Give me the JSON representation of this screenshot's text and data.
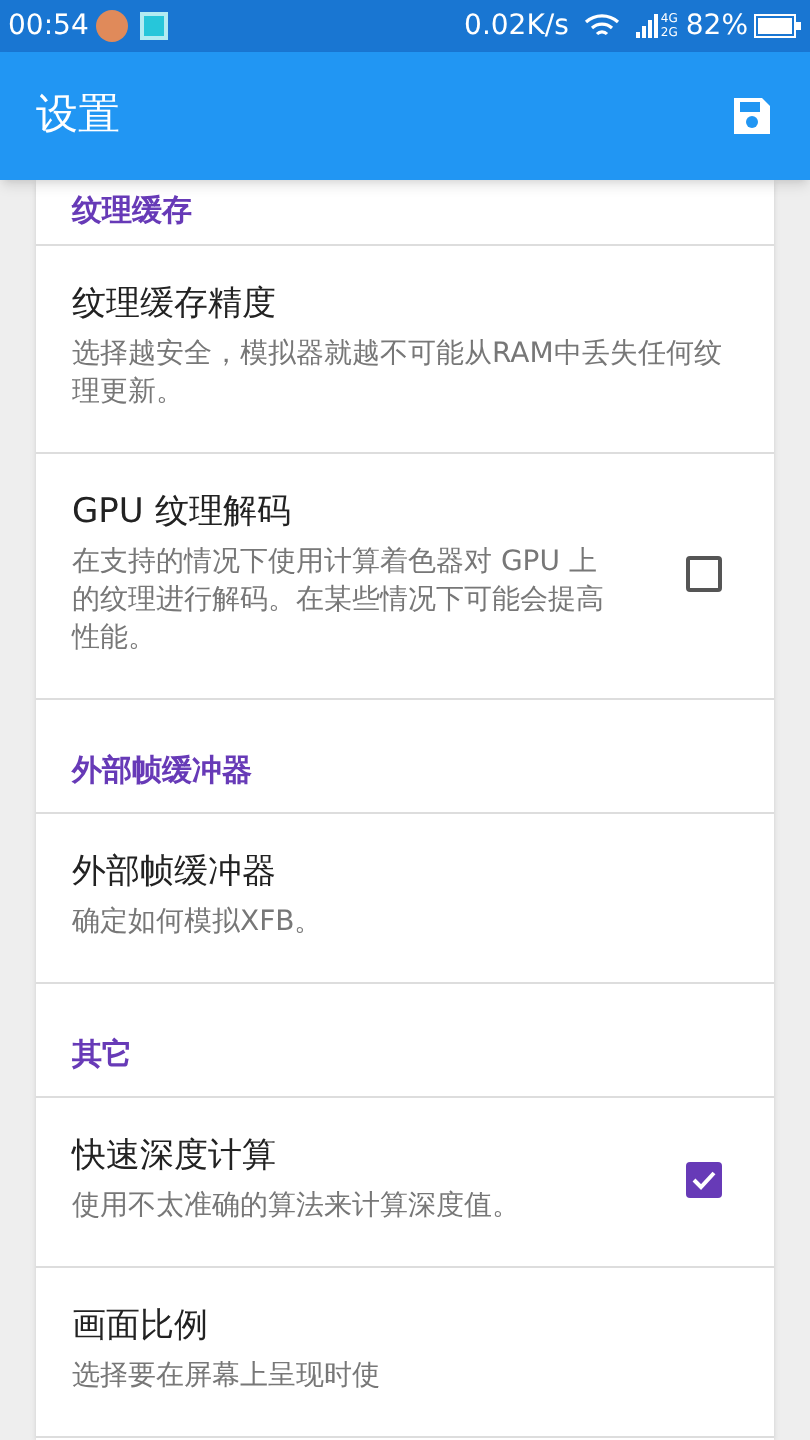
{
  "status_bar": {
    "time": "00:54",
    "net_speed": "0.02K/s",
    "signal_top": "4G",
    "signal_bottom": "2G",
    "battery": "82%"
  },
  "app_bar": {
    "title": "设置"
  },
  "items": [
    {
      "kind": "header",
      "label": "纹理缓存"
    },
    {
      "kind": "setting",
      "title": "纹理缓存精度",
      "description": "选择越安全，模拟器就越不可能从RAM中丢失任何纹理更新。"
    },
    {
      "kind": "setting",
      "title": "GPU 纹理解码",
      "description": "在支持的情况下使用计算着色器对 GPU 上的纹理进行解码。在某些情况下可能会提高性能。",
      "checked": false
    },
    {
      "kind": "header",
      "label": "外部帧缓冲器"
    },
    {
      "kind": "setting",
      "title": "外部帧缓冲器",
      "description": "确定如何模拟XFB。"
    },
    {
      "kind": "header",
      "label": "其它"
    },
    {
      "kind": "setting",
      "title": "快速深度计算",
      "description": "使用不太准确的算法来计算深度值。",
      "checked": true
    },
    {
      "kind": "setting",
      "title": "画面比例",
      "description": "选择要在屏幕上呈现时使"
    }
  ]
}
